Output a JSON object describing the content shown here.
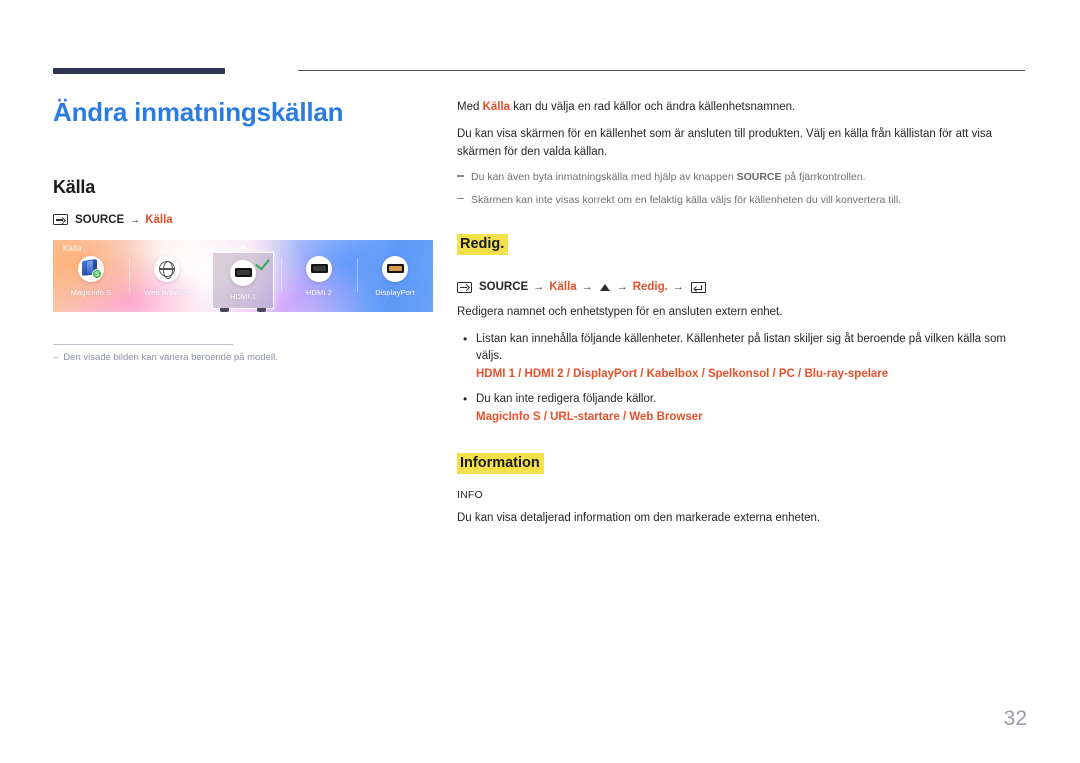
{
  "page": {
    "title": "Ändra inmatningskällan",
    "number": "32"
  },
  "left": {
    "section_title": "Källa",
    "path": {
      "source_label": "SOURCE",
      "arrow": "→",
      "target": "Källa"
    },
    "screenshot": {
      "caption": "Källa",
      "items": [
        {
          "name": "MagicInfo S",
          "icon": "magicinfo-icon",
          "selected": false
        },
        {
          "name": "Web Browser",
          "icon": "globe-icon",
          "selected": false
        },
        {
          "name": "HDMI 1",
          "icon": "hdmi-port-icon",
          "selected": true
        },
        {
          "name": "HDMI 2",
          "icon": "hdmi-port-icon",
          "selected": false
        },
        {
          "name": "DisplayPort",
          "icon": "displayport-icon",
          "selected": false
        }
      ]
    },
    "footnote": {
      "dash": "–",
      "text": "Den visade bilden kan variera beroende på modell."
    }
  },
  "right": {
    "intro": {
      "p1_before": "Med ",
      "p1_keyword": "Källa",
      "p1_after": " kan du välja en rad källor och ändra källenhetsnamnen.",
      "p2": "Du kan visa skärmen för en källenhet som är ansluten till produkten. Välj en källa från källistan för att visa skärmen för den valda källan."
    },
    "notes": [
      {
        "before": "Du kan även byta inmatningskälla med hjälp av knappen ",
        "bold": "SOURCE",
        "after": " på fjärrkontrollen."
      },
      {
        "before": "Skärmen kan inte visas korrekt om en felaktig källa väljs för källenheten du vill konvertera till.",
        "bold": "",
        "after": ""
      }
    ],
    "redig": {
      "heading": "Redig.",
      "path": {
        "source_label": "SOURCE",
        "arrow": "→",
        "step1": "Källa",
        "step2": "Redig."
      },
      "lead": "Redigera namnet och enhetstypen för en ansluten extern enhet.",
      "bullets": [
        {
          "text": "Listan kan innehålla följande källenheter. Källenheter på listan skiljer sig åt beroende på vilken källa som väljs.",
          "values": "HDMI 1 / HDMI 2 / DisplayPort / Kabelbox / Spelkonsol / PC / Blu-ray-spelare"
        },
        {
          "text": "Du kan inte redigera följande källor.",
          "values": "MagicInfo S / URL-startare / Web Browser"
        }
      ]
    },
    "information": {
      "heading": "Information",
      "label": "INFO",
      "text": "Du kan visa detaljerad information om den markerade externa enheten."
    }
  },
  "colors": {
    "heading_blue": "#2b7ce0",
    "accent_orange": "#e8502a",
    "highlight_yellow": "#f4e04a",
    "rule_navy": "#2f3153",
    "muted_gray": "#8b8fa3"
  }
}
